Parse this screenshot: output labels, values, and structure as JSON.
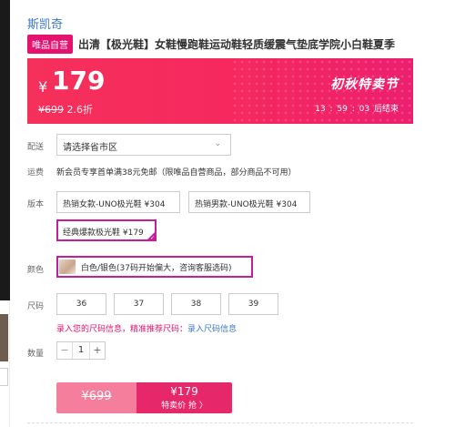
{
  "brand": "斯凯奇",
  "product": {
    "tag": "唯品自营",
    "title": "出清【极光鞋】女鞋慢跑鞋运动鞋轻质缓震气垫底学院小白鞋夏季"
  },
  "price": {
    "currency": "¥",
    "current": "179",
    "original": "¥699",
    "discount": "2.6折",
    "festival": "初秋特卖节",
    "countdown": {
      "h": "13",
      "m": "59",
      "s": "03",
      "suffix": "后结束"
    },
    "banner_color": "#f5305a"
  },
  "delivery": {
    "label": "配送",
    "select_placeholder": "请选择省市区"
  },
  "shipping": {
    "label": "运费",
    "text": "新会员专享首单满38元免邮（限唯品自营商品，部分商品不可用）"
  },
  "version": {
    "label": "版本",
    "options": [
      {
        "label": "热销女款-UNO极光鞋 ¥304",
        "selected": false
      },
      {
        "label": "热销男款-UNO极光鞋 ¥304",
        "selected": false
      },
      {
        "label": "经典爆款极光鞋 ¥179",
        "selected": true
      }
    ]
  },
  "color": {
    "label": "颜色",
    "selected": "白色/银色(37码开始偏大，咨询客服选码)"
  },
  "size": {
    "label": "尺码",
    "options": [
      "36",
      "37",
      "38",
      "39"
    ],
    "tip_prefix": "录入您的尺码信息，精准推荐尺码：",
    "tip_link": "录入尺码信息"
  },
  "quantity": {
    "label": "数量",
    "minus": "−",
    "value": "1",
    "plus": "+"
  },
  "buy": {
    "original_price": "¥699",
    "price": "¥179",
    "action": "特卖价 抢 〉"
  },
  "colors": {
    "accent": "#e5126f",
    "select_border": "#c21e9d",
    "link": "#3d78c7"
  }
}
